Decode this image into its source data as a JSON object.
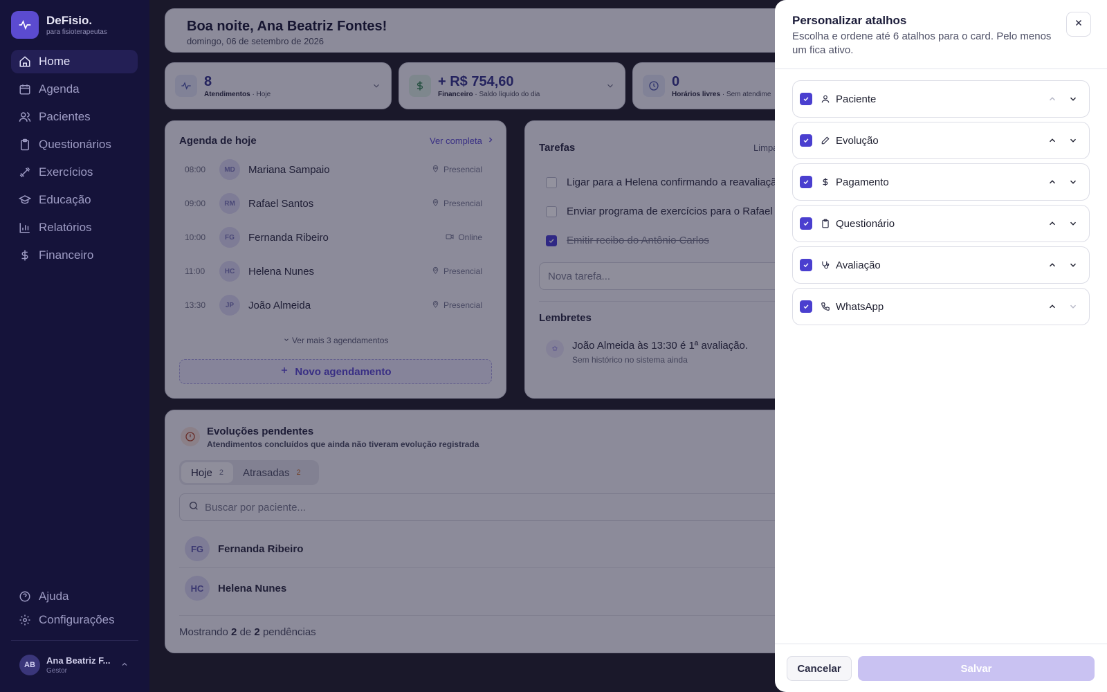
{
  "brand": {
    "name": "DeFisio.",
    "tagline": "para fisioterapeutas"
  },
  "sidebar": {
    "items": [
      {
        "label": "Home",
        "icon": "home-icon",
        "active": true
      },
      {
        "label": "Agenda",
        "icon": "calendar-icon"
      },
      {
        "label": "Pacientes",
        "icon": "users-icon"
      },
      {
        "label": "Questionários",
        "icon": "clipboard-icon"
      },
      {
        "label": "Exercícios",
        "icon": "dumbbell-icon"
      },
      {
        "label": "Educação",
        "icon": "graduation-cap-icon"
      },
      {
        "label": "Relatórios",
        "icon": "bar-chart-icon"
      },
      {
        "label": "Financeiro",
        "icon": "dollar-icon"
      }
    ],
    "bottom": [
      {
        "label": "Ajuda",
        "icon": "help-icon"
      },
      {
        "label": "Configurações",
        "icon": "gear-icon"
      }
    ],
    "user": {
      "initials": "AB",
      "name": "Ana Beatriz F...",
      "role": "Gestor"
    }
  },
  "header": {
    "greeting": "Boa noite, Ana Beatriz Fontes!",
    "date": "domingo, 06 de setembro de 2026"
  },
  "stats": [
    {
      "value": "8",
      "label": "Atendimentos",
      "detail": "· Hoje",
      "icon": "activity-icon"
    },
    {
      "value": "+ R$ 754,60",
      "label": "Financeiro",
      "detail": "· Saldo líquido do dia",
      "icon": "dollar-icon"
    },
    {
      "value": "0",
      "label": "Horários livres",
      "detail": "· Sem atendime",
      "icon": "clock-icon"
    }
  ],
  "agenda": {
    "title": "Agenda de hoje",
    "link": "Ver completa",
    "rows": [
      {
        "time": "08:00",
        "initials": "MD",
        "name": "Mariana Sampaio",
        "mode": "Presencial",
        "mode_icon": "pin-icon"
      },
      {
        "time": "09:00",
        "initials": "RM",
        "name": "Rafael Santos",
        "mode": "Presencial",
        "mode_icon": "pin-icon"
      },
      {
        "time": "10:00",
        "initials": "FG",
        "name": "Fernanda Ribeiro",
        "mode": "Online",
        "mode_icon": "video-icon"
      },
      {
        "time": "11:00",
        "initials": "HC",
        "name": "Helena Nunes",
        "mode": "Presencial",
        "mode_icon": "pin-icon"
      },
      {
        "time": "13:30",
        "initials": "JP",
        "name": "João Almeida",
        "mode": "Presencial",
        "mode_icon": "pin-icon"
      }
    ],
    "more": "Ver mais 3 agendamentos",
    "new_button": "Novo agendamento"
  },
  "tarefas": {
    "title": "Tarefas",
    "clear": "Limpa",
    "items": [
      {
        "text": "Ligar para a Helena confirmando a reavaliação",
        "done": false
      },
      {
        "text": "Enviar programa de exercícios para o Rafael",
        "done": false
      },
      {
        "text": "Emitir recibo do Antônio Carlos",
        "done": true
      }
    ],
    "new_placeholder": "Nova tarefa...",
    "lembretes_title": "Lembretes",
    "lembrete": {
      "text": "João Almeida às 13:30 é 1ª avaliação.",
      "sub": "Sem histórico no sistema ainda"
    }
  },
  "evolucoes": {
    "title": "Evoluções pendentes",
    "subtitle": "Atendimentos concluídos que ainda não tiveram evolução registrada",
    "tabs": [
      {
        "label": "Hoje",
        "count": "2"
      },
      {
        "label": "Atrasadas",
        "count": "2"
      }
    ],
    "search_placeholder": "Buscar por paciente...",
    "patients": [
      {
        "initials": "FG",
        "name": "Fernanda Ribeiro"
      },
      {
        "initials": "HC",
        "name": "Helena Nunes"
      }
    ],
    "footer": {
      "prefix": "Mostrando",
      "shown": "2",
      "middle": "de",
      "total": "2",
      "suffix": "pendências"
    }
  },
  "panel": {
    "title": "Personalizar atalhos",
    "description": "Escolha e ordene até 6 atalhos para o card. Pelo menos um fica ativo.",
    "items": [
      {
        "label": "Paciente",
        "icon": "user-icon",
        "checked": true
      },
      {
        "label": "Evolução",
        "icon": "pen-icon",
        "checked": true
      },
      {
        "label": "Pagamento",
        "icon": "dollar-icon",
        "checked": true
      },
      {
        "label": "Questionário",
        "icon": "clipboard-icon",
        "checked": true
      },
      {
        "label": "Avaliação",
        "icon": "stethoscope-icon",
        "checked": true
      },
      {
        "label": "WhatsApp",
        "icon": "phone-icon",
        "checked": true
      }
    ],
    "cancel": "Cancelar",
    "save": "Salvar"
  },
  "colors": {
    "accent": "#5b4bd0",
    "sidebar": "#15133a",
    "save_disabled": "#c9c2f2"
  }
}
